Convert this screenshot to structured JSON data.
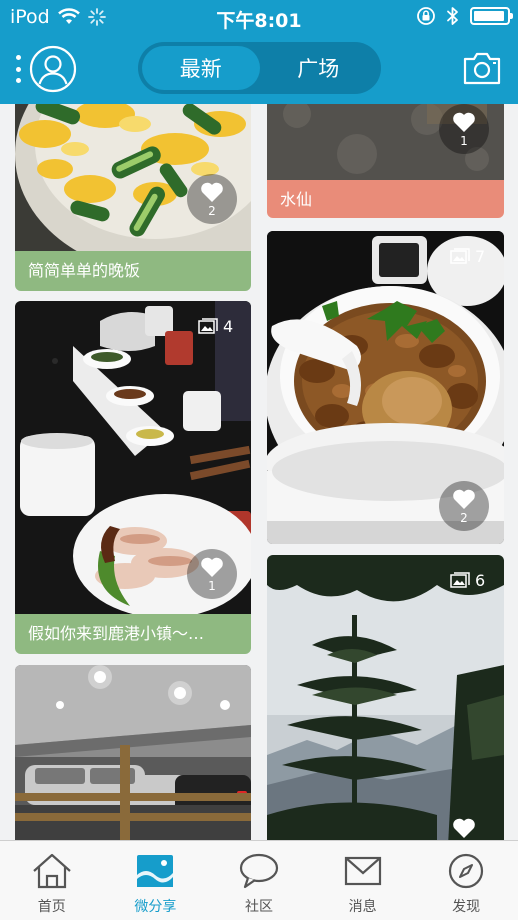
{
  "status_bar": {
    "carrier": "iPod",
    "time": "下午8:01",
    "battery_level": 0.95
  },
  "header": {
    "tabs": [
      {
        "label": "最新",
        "active": true
      },
      {
        "label": "广场",
        "active": false
      }
    ]
  },
  "feed": {
    "cards": [
      {
        "title": "简简单单的晚饭",
        "likes": "2",
        "title_color": "#8fb981",
        "photo": "cucumber-eggs"
      },
      {
        "title": "水仙",
        "likes": "1",
        "title_color": "#e98c79",
        "photo": "dark-table"
      },
      {
        "title": "假如你来到鹿港小镇～…",
        "likes": "1",
        "photo_count": "4",
        "title_color": "#8fb981",
        "photo": "restaurant-table"
      },
      {
        "likes": "2",
        "photo_count": "7",
        "photo": "braised-pork-bowl"
      },
      {
        "photo": "parking-garage"
      },
      {
        "photo_count": "6",
        "photo": "mountain-pine"
      }
    ]
  },
  "tabbar": {
    "tabs": [
      {
        "label": "首页",
        "icon": "home-icon",
        "active": false
      },
      {
        "label": "微分享",
        "icon": "photo-share-icon",
        "active": true
      },
      {
        "label": "社区",
        "icon": "chat-bubble-icon",
        "active": false
      },
      {
        "label": "消息",
        "icon": "envelope-icon",
        "active": false
      },
      {
        "label": "发现",
        "icon": "compass-icon",
        "active": false
      }
    ]
  },
  "colors": {
    "brand": "#169dcb",
    "brand_dark": "#0e7fa8",
    "green_title": "#8fb981",
    "salmon_title": "#e98c79"
  }
}
